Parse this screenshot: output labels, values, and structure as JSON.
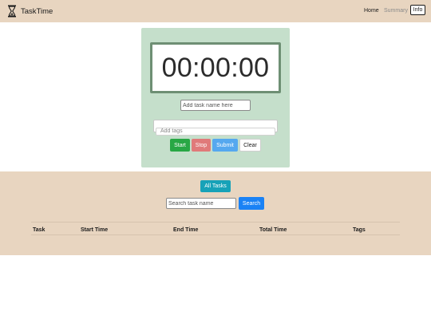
{
  "navbar": {
    "brand_icon": "hourglass-icon",
    "brand": "TaskTime",
    "links": [
      {
        "label": "Home",
        "active": true
      },
      {
        "label": "Summary",
        "active": false
      }
    ],
    "info_label": "Info"
  },
  "timer": {
    "display": "00:00:00",
    "task_placeholder": "Add task name here",
    "tags_placeholder": "Add tags",
    "buttons": {
      "start": "Start",
      "stop": "Stop",
      "submit": "Submit",
      "clear": "Clear"
    }
  },
  "tasks": {
    "all_tasks_label": "All Tasks",
    "search_placeholder": "Search task name",
    "search_label": "Search",
    "columns": [
      "Task",
      "Start Time",
      "End Time",
      "Total Time",
      "Tags"
    ],
    "rows": []
  },
  "colors": {
    "navbar_bg": "#e8d5c0",
    "card_bg": "#c5dfcb",
    "start": "#28a745",
    "stop": "#e07a7a",
    "submit": "#55a8ef",
    "all_tasks": "#17a2b8",
    "search": "#1a82f5"
  }
}
